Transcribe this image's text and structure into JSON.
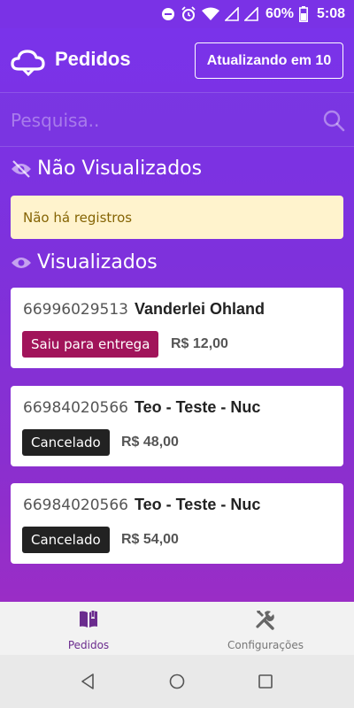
{
  "status_bar": {
    "battery": "60%",
    "time": "5:08",
    "icons": [
      "do-not-disturb-icon",
      "alarm-icon",
      "wifi-icon",
      "signal-icon",
      "battery-icon"
    ]
  },
  "header": {
    "title": "Pedidos",
    "refresh_button": "Atualizando em 10"
  },
  "search": {
    "placeholder": "Pesquisa.."
  },
  "sections": {
    "unviewed": {
      "title": "Não Visualizados",
      "empty_message": "Não há registros"
    },
    "viewed": {
      "title": "Visualizados"
    }
  },
  "orders": [
    {
      "phone": "66996029513",
      "name": "Vanderlei Ohland",
      "status": "Saiu para entrega",
      "price": "R$ 12,00",
      "status_color": "#a1145a"
    },
    {
      "phone": "66984020566",
      "name": "Teo - Teste - Nuc",
      "status": "Cancelado",
      "price": "R$ 48,00",
      "status_color": "#222222"
    },
    {
      "phone": "66984020566",
      "name": "Teo - Teste - Nuc",
      "status": "Cancelado",
      "price": "R$ 54,00",
      "status_color": "#222222"
    }
  ],
  "bottom_nav": {
    "items": [
      {
        "label": "Pedidos",
        "icon": "book-icon",
        "active": true
      },
      {
        "label": "Configurações",
        "icon": "tools-icon",
        "active": false
      }
    ]
  },
  "colors": {
    "primary": "#7a33ea",
    "accent": "#6b2c8e",
    "warning_bg": "#fff3cd",
    "warning_text": "#856404"
  }
}
